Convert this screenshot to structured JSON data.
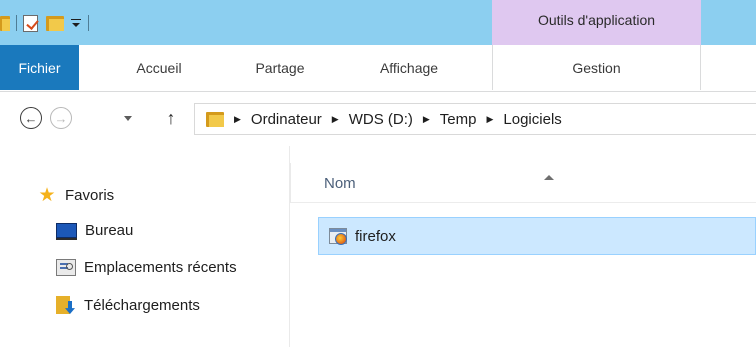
{
  "ribbon": {
    "contextual_header": "Outils d'application",
    "tabs": {
      "file": "Fichier",
      "home": "Accueil",
      "share": "Partage",
      "view": "Affichage",
      "manage": "Gestion"
    },
    "colors": {
      "titlebar": "#8ccff0",
      "contextual": "#dfc8f0",
      "file_tab": "#1a79bd"
    }
  },
  "quick_access_toolbar": {
    "icons": [
      "folder-icon",
      "properties-icon",
      "new-folder-icon",
      "customize-dropdown-icon"
    ]
  },
  "navigation": {
    "back_icon": "arrow-left-circle-icon",
    "forward_icon": "arrow-right-circle-icon",
    "up_icon": "arrow-up-icon",
    "path": [
      "Ordinateur",
      "WDS (D:)",
      "Temp",
      "Logiciels"
    ]
  },
  "navpane": {
    "favorites": "Favoris",
    "items": [
      {
        "label": "Bureau",
        "icon": "desktop-icon"
      },
      {
        "label": "Emplacements récents",
        "icon": "recent-places-icon"
      },
      {
        "label": "Téléchargements",
        "icon": "downloads-icon"
      }
    ]
  },
  "content": {
    "column_name": "Nom",
    "files": [
      {
        "name": "firefox",
        "icon": "installer-icon",
        "selected": true
      }
    ],
    "selection_color": "#cce8ff"
  }
}
